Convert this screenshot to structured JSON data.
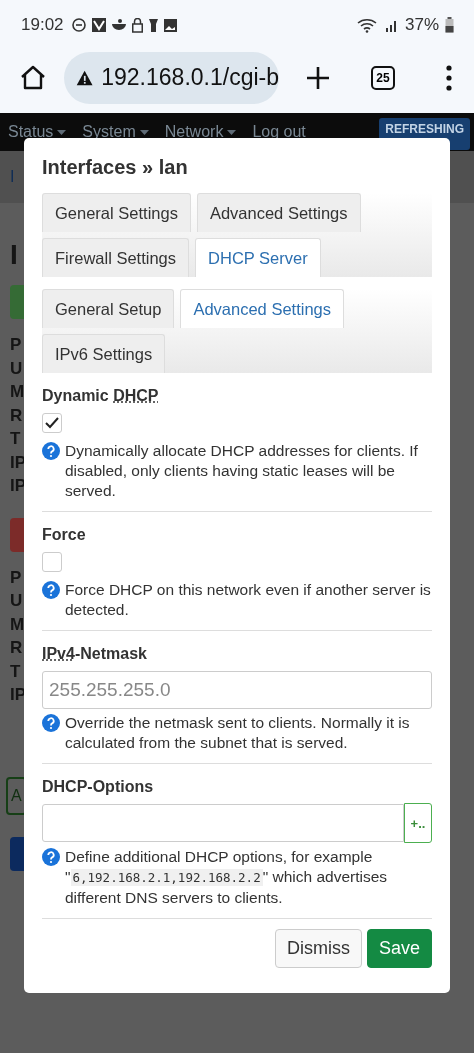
{
  "status_bar": {
    "time": "19:02",
    "battery": "37%"
  },
  "browser": {
    "url": "192.168.0.1/cgi-b",
    "tab_count": "25"
  },
  "nav": {
    "items": [
      "Status",
      "System",
      "Network"
    ],
    "logout": "Log out",
    "badge": "REFRESHING"
  },
  "background": {
    "crumb": "I",
    "heading": "I",
    "rows_1": [
      "P",
      "U",
      "M",
      "R",
      "T",
      "IP",
      "IP"
    ],
    "rows_2": [
      "P",
      "U",
      "M",
      "R",
      "T",
      "IP"
    ],
    "button": "A"
  },
  "modal": {
    "title": "Interfaces » lan",
    "tabs": [
      {
        "label": "General Settings",
        "selected": false
      },
      {
        "label": "Advanced Settings",
        "selected": false
      },
      {
        "label": "Firewall Settings",
        "selected": false
      },
      {
        "label": "DHCP Server",
        "selected": true
      }
    ],
    "subtabs": [
      {
        "label": "General Setup",
        "selected": false
      },
      {
        "label": "Advanced Settings",
        "selected": true
      },
      {
        "label": "IPv6 Settings",
        "selected": false
      }
    ],
    "fields": [
      {
        "kind": "checkbox",
        "label": [
          {
            "text": "Dynamic "
          },
          {
            "text": "DHCP",
            "abbr": true
          }
        ],
        "checked": true,
        "description": [
          {
            "text": "Dynamically allocate DHCP addresses for clients. If disabled, only clients having static leases will be served."
          }
        ]
      },
      {
        "kind": "checkbox",
        "label": [
          {
            "text": "Force"
          }
        ],
        "checked": false,
        "description": [
          {
            "text": "Force DHCP on this network even if another server is detected."
          }
        ]
      },
      {
        "kind": "text",
        "label": [
          {
            "text": "IPv4",
            "abbr": true
          },
          {
            "text": "-Netmask"
          }
        ],
        "placeholder": "255.255.255.0",
        "description": [
          {
            "text": "Override the netmask sent to clients. Normally it is calculated from the subnet that is served."
          }
        ]
      },
      {
        "kind": "list",
        "label": [
          {
            "text": "DHCP-Options"
          }
        ],
        "add": "+..",
        "description": [
          {
            "text": "Define additional DHCP options, for example \""
          },
          {
            "text": "6,192.168.2.1,192.168.2.2",
            "code": true
          },
          {
            "text": "\" which advertises different DNS servers to clients."
          }
        ]
      }
    ],
    "buttons": [
      {
        "label": "Dismiss",
        "kind": "secondary"
      },
      {
        "label": "Save",
        "kind": "primary"
      }
    ]
  }
}
